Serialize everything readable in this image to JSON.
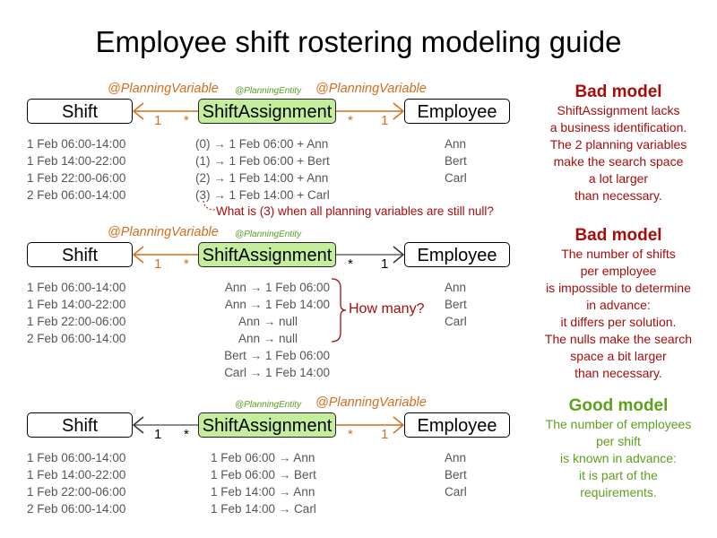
{
  "title": "Employee shift rostering modeling guide",
  "colors": {
    "planning_variable": "#d46d1c",
    "planning_entity": "#5a9e1f",
    "entity_fill": "#c5ee9c",
    "bad": "#a50d0d",
    "good": "#5ea01c",
    "neutral_line": "#666666"
  },
  "sections": [
    {
      "labels": {
        "left_var": "@PlanningVariable",
        "entity": "@PlanningEntity",
        "right_var": "@PlanningVariable"
      },
      "boxes": {
        "shift": "Shift",
        "assignment": "ShiftAssignment",
        "employee": "Employee"
      },
      "left_mult": {
        "near_shift": "1",
        "near_assignment": "*"
      },
      "right_mult": {
        "near_assignment": "*",
        "near_employee": "1"
      },
      "shifts": [
        "1 Feb 06:00-14:00",
        "1 Feb 14:00-22:00",
        "1 Feb 22:00-06:00",
        "2 Feb 06:00-14:00"
      ],
      "assignments": [
        "(0) → 1 Feb 06:00 + Ann",
        "(1) → 1 Feb 06:00 + Bert",
        "(2) → 1 Feb 14:00 + Ann",
        "(3) → 1 Feb 14:00 + Carl"
      ],
      "employees": [
        "Ann",
        "Bert",
        "Carl"
      ],
      "callout": "What is (3) when all planning variables are still null?",
      "note": {
        "heading": "Bad model",
        "lines": [
          "ShiftAssignment lacks",
          "a business identification.",
          "The 2 planning variables",
          "make the search space",
          "a lot larger",
          "than necessary."
        ]
      }
    },
    {
      "labels": {
        "left_var": "@PlanningVariable",
        "entity": "@PlanningEntity"
      },
      "boxes": {
        "shift": "Shift",
        "assignment": "ShiftAssignment",
        "employee": "Employee"
      },
      "left_mult": {
        "near_shift": "1",
        "near_assignment": "*"
      },
      "right_mult": {
        "near_assignment": "*",
        "near_employee": "1"
      },
      "shifts": [
        "1 Feb 06:00-14:00",
        "1 Feb 14:00-22:00",
        "1 Feb 22:00-06:00",
        "2 Feb 06:00-14:00"
      ],
      "assignments": [
        "Ann → 1 Feb 06:00",
        "Ann → 1 Feb 14:00",
        "Ann → null",
        "Ann → null",
        "Bert → 1 Feb 06:00",
        "Carl → 1 Feb 14:00"
      ],
      "employees": [
        "Ann",
        "Bert",
        "Carl"
      ],
      "brace_label": "How many?",
      "note": {
        "heading": "Bad model",
        "lines": [
          "The number of shifts",
          "per employee",
          "is impossible to determine",
          "in advance:",
          "it differs per solution.",
          "The nulls make the search",
          "space a bit larger",
          "than necessary."
        ]
      }
    },
    {
      "labels": {
        "entity": "@PlanningEntity",
        "right_var": "@PlanningVariable"
      },
      "boxes": {
        "shift": "Shift",
        "assignment": "ShiftAssignment",
        "employee": "Employee"
      },
      "left_mult": {
        "near_shift": "1",
        "near_assignment": "*"
      },
      "right_mult": {
        "near_assignment": "*",
        "near_employee": "1"
      },
      "shifts": [
        "1 Feb 06:00-14:00",
        "1 Feb 14:00-22:00",
        "1 Feb 22:00-06:00",
        "2 Feb 06:00-14:00"
      ],
      "assignments": [
        "1 Feb 06:00 → Ann",
        "1 Feb 06:00 → Bert",
        "1 Feb 14:00 → Ann",
        "1 Feb 14:00 → Carl"
      ],
      "employees": [
        "Ann",
        "Bert",
        "Carl"
      ],
      "note": {
        "heading": "Good model",
        "lines": [
          "The number of employees",
          "per shift",
          "is known in advance:",
          "it is part of the",
          "requirements."
        ]
      }
    }
  ]
}
